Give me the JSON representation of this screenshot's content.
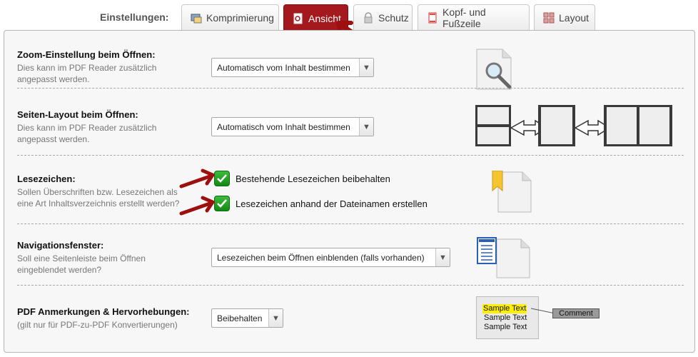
{
  "tabs": {
    "label": "Einstellungen:",
    "items": [
      {
        "label": "Komprimierung"
      },
      {
        "label": "Ansicht"
      },
      {
        "label": "Schutz"
      },
      {
        "label": "Kopf- und Fußzeile"
      },
      {
        "label": "Layout"
      }
    ]
  },
  "sections": {
    "zoom": {
      "title": "Zoom-Einstellung beim Öffnen:",
      "desc": "Dies kann im PDF Reader zusätzlich angepasst werden.",
      "select": "Automatisch vom Inhalt bestimmen"
    },
    "layout": {
      "title": "Seiten-Layout beim Öffnen:",
      "desc": "Dies kann im PDF Reader zusätzlich angepasst werden.",
      "select": "Automatisch vom Inhalt bestimmen"
    },
    "bookmarks": {
      "title": "Lesezeichen:",
      "desc": "Sollen Überschriften bzw. Lesezeichen als eine Art Inhaltsverzeichnis erstellt werden?",
      "options": [
        {
          "label": "Bestehende Lesezeichen beibehalten",
          "checked": true
        },
        {
          "label": "Lesezeichen anhand der Dateinamen erstellen",
          "checked": true
        }
      ]
    },
    "nav": {
      "title": "Navigationsfenster:",
      "desc": "Soll eine Seitenleiste beim Öffnen eingeblendet werden?",
      "select": "Lesezeichen beim Öffnen einblenden (falls vorhanden)"
    },
    "annotations": {
      "title": "PDF Anmerkungen & Hervorhebungen:",
      "desc": "(gilt nur für PDF-zu-PDF Konvertierungen)",
      "select": "Beibehalten",
      "sample_lines": [
        "Sample Text",
        "Sample Text",
        "Sample Text"
      ],
      "comment": "Comment"
    }
  },
  "colors": {
    "accent": "#a3191d",
    "check": "#1f9e1f",
    "highlight": "#ffef00"
  }
}
